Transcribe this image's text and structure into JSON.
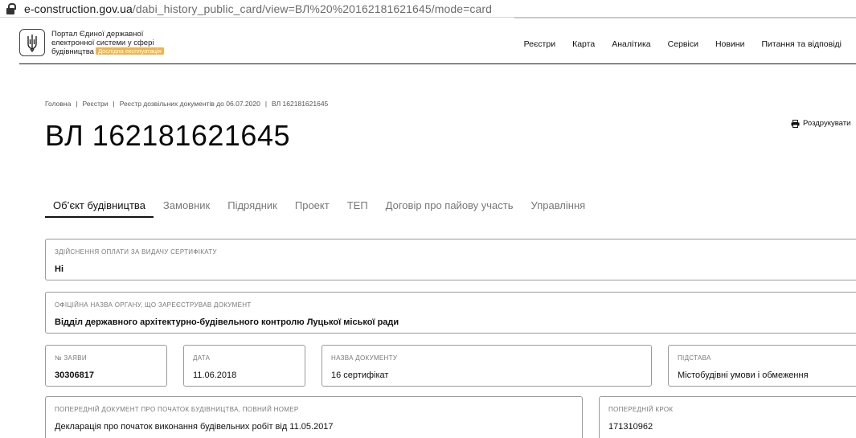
{
  "browser": {
    "url_host": "e-construction.gov.ua",
    "url_path": "/dabi_history_public_card/view=ВЛ%20%20162181621645/mode=card"
  },
  "header": {
    "logo_icon": "trident-icon",
    "logo_line1": "Портал Єдиної державної",
    "logo_line2": "електронної системи у сфері",
    "logo_line3": "будівництва",
    "badge": "Дослідна експлуатація",
    "nav": [
      "Реєстри",
      "Карта",
      "Аналітика",
      "Сервіси",
      "Новини",
      "Питання та відповіді"
    ]
  },
  "breadcrumb": [
    "Головна",
    "Реєстри",
    "Реєстр дозвільних документів до 06.07.2020",
    "ВЛ 162181621645"
  ],
  "page": {
    "title": "ВЛ 162181621645",
    "print_label": "Роздрукувати"
  },
  "tabs": [
    "Об’єкт будівництва",
    "Замовник",
    "Підрядник",
    "Проект",
    "ТЕП",
    "Договір про пайову участь",
    "Управління"
  ],
  "fields": {
    "payment": {
      "label": "Здійснення оплати за видачу сертифікату",
      "value": "Ні"
    },
    "authority": {
      "label": "Офіційна назва органу, що зареєстрував документ",
      "value": "Відділ державного архітектурно-будівельного контролю Луцької міської ради"
    },
    "app_no": {
      "label": "№ заяви",
      "value": "30306817"
    },
    "date": {
      "label": "Дата",
      "value": "11.06.2018"
    },
    "doc_name": {
      "label": "Назва документу",
      "value": "16 сертифікат"
    },
    "basis": {
      "label": "Підстава",
      "value": "Містобудівні умови і обмеження"
    },
    "prev_doc": {
      "label": "Попередній документ про початок будівництва, повний номер",
      "value": "Декларація про початок виконання будівельних робіт від 11.05.2017"
    },
    "prev_step": {
      "label": "Попередній крок",
      "value": "171310962"
    }
  }
}
